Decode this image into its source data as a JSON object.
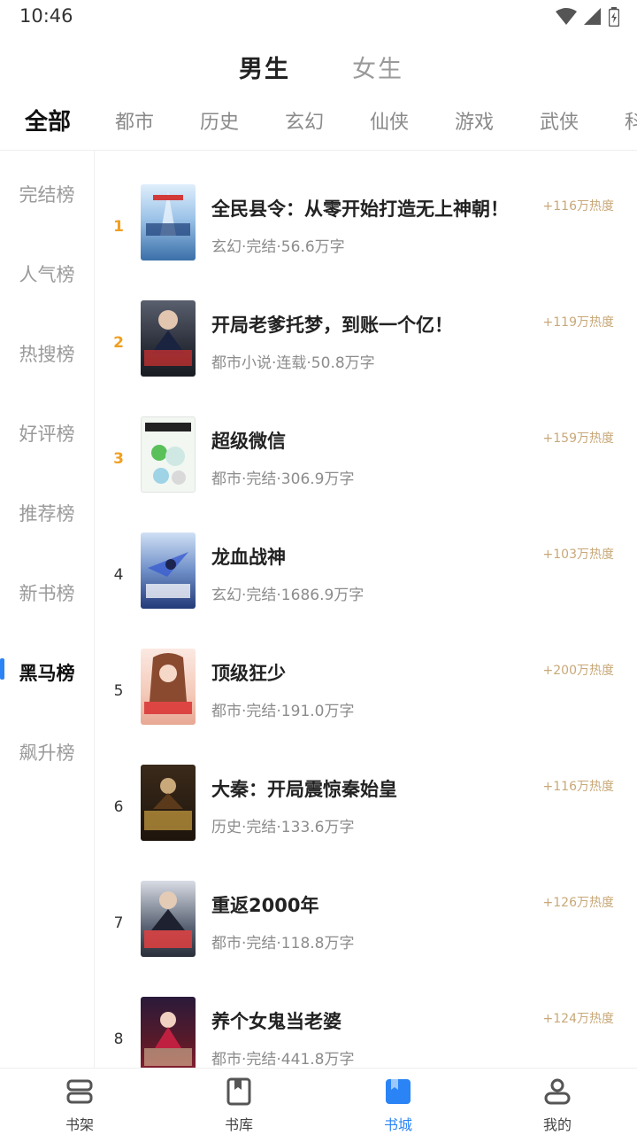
{
  "status": {
    "time": "10:46"
  },
  "gender_tabs": [
    {
      "label": "男生",
      "active": true
    },
    {
      "label": "女生",
      "active": false
    }
  ],
  "categories": [
    {
      "label": "全部",
      "active": true
    },
    {
      "label": "都市"
    },
    {
      "label": "历史"
    },
    {
      "label": "玄幻"
    },
    {
      "label": "仙侠"
    },
    {
      "label": "游戏"
    },
    {
      "label": "武侠"
    },
    {
      "label": "科"
    }
  ],
  "sidebar": [
    {
      "label": "完结榜"
    },
    {
      "label": "人气榜"
    },
    {
      "label": "热搜榜"
    },
    {
      "label": "好评榜"
    },
    {
      "label": "推荐榜"
    },
    {
      "label": "新书榜"
    },
    {
      "label": "黑马榜",
      "active": true
    },
    {
      "label": "飙升榜"
    }
  ],
  "books": [
    {
      "rank": "1",
      "title": "全民县令：从零开始打造无上神朝！",
      "meta": "玄幻·完结·56.6万字",
      "heat": "+116万热度"
    },
    {
      "rank": "2",
      "title": "开局老爹托梦，到账一个亿！",
      "meta": "都市小说·连载·50.8万字",
      "heat": "+119万热度"
    },
    {
      "rank": "3",
      "title": "超级微信",
      "meta": "都市·完结·306.9万字",
      "heat": "+159万热度"
    },
    {
      "rank": "4",
      "title": "龙血战神",
      "meta": "玄幻·完结·1686.9万字",
      "heat": "+103万热度"
    },
    {
      "rank": "5",
      "title": "顶级狂少",
      "meta": "都市·完结·191.0万字",
      "heat": "+200万热度"
    },
    {
      "rank": "6",
      "title": "大秦：开局震惊秦始皇",
      "meta": "历史·完结·133.6万字",
      "heat": "+116万热度"
    },
    {
      "rank": "7",
      "title": "重返2000年",
      "meta": "都市·完结·118.8万字",
      "heat": "+126万热度"
    },
    {
      "rank": "8",
      "title": "养个女鬼当老婆",
      "meta": "都市·完结·441.8万字",
      "heat": "+124万热度"
    }
  ],
  "bottom_nav": [
    {
      "label": "书架",
      "icon": "bookshelf-icon"
    },
    {
      "label": "书库",
      "icon": "library-icon"
    },
    {
      "label": "书城",
      "icon": "bookstore-icon",
      "active": true
    },
    {
      "label": "我的",
      "icon": "profile-icon"
    }
  ],
  "colors": {
    "accent": "#2a84f5",
    "rank_top": "#f0a020",
    "heat": "#c8a878"
  }
}
